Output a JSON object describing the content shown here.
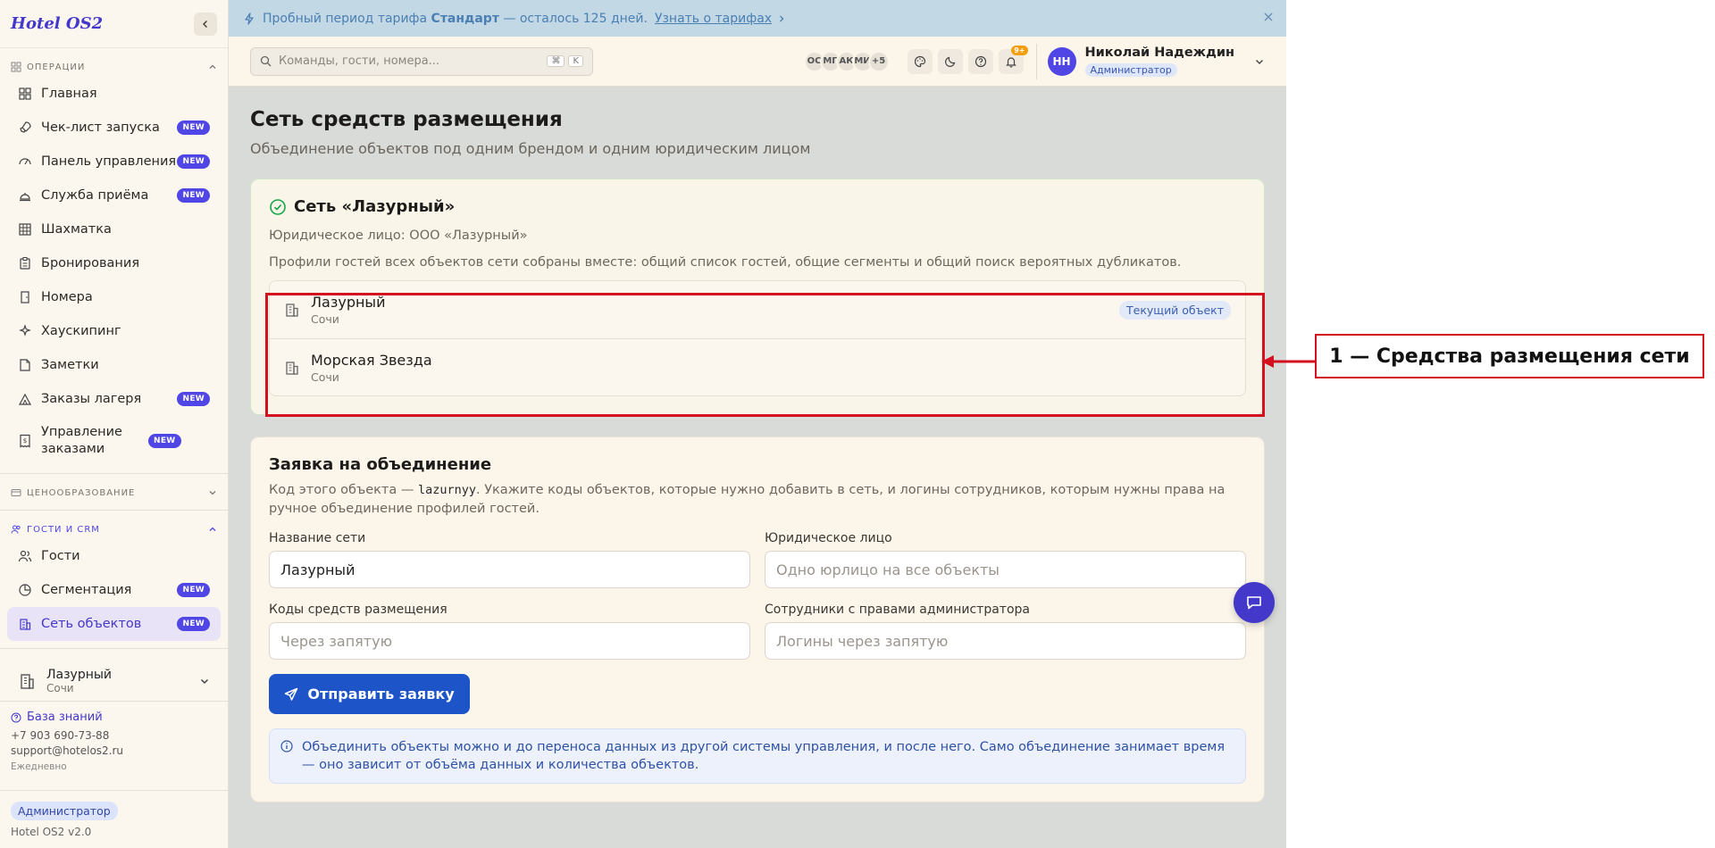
{
  "app": {
    "logo": "Hotel OS2"
  },
  "sidebar": {
    "sections": {
      "operations": "ОПЕРАЦИИ",
      "pricing": "ЦЕНООБРАЗОВАНИЕ",
      "guests_crm": "ГОСТИ И CRM"
    },
    "new_badge": "NEW",
    "items": [
      {
        "label": "Главная",
        "icon": "grid-icon",
        "new": false
      },
      {
        "label": "Чек-лист запуска",
        "icon": "rocket-icon",
        "new": true
      },
      {
        "label": "Панель управления",
        "icon": "gauge-icon",
        "new": true
      },
      {
        "label": "Служба приёма",
        "icon": "concierge-bell-icon",
        "new": true
      },
      {
        "label": "Шахматка",
        "icon": "table-icon",
        "new": false
      },
      {
        "label": "Бронирования",
        "icon": "clipboard-icon",
        "new": false
      },
      {
        "label": "Номера",
        "icon": "door-icon",
        "new": false
      },
      {
        "label": "Хаускипинг",
        "icon": "sparkles-icon",
        "new": false
      },
      {
        "label": "Заметки",
        "icon": "note-icon",
        "new": false
      },
      {
        "label": "Заказы лагеря",
        "icon": "tent-icon",
        "new": true
      },
      {
        "label": "Управление заказами",
        "icon": "receipt-icon",
        "new": true
      }
    ],
    "crm_items": [
      {
        "label": "Гости",
        "icon": "users-icon",
        "new": false
      },
      {
        "label": "Сегментация",
        "icon": "pie-icon",
        "new": true
      },
      {
        "label": "Сеть объектов",
        "icon": "buildings-icon",
        "new": true,
        "active": true
      }
    ],
    "object_selector": {
      "name": "Лазурный",
      "city": "Сочи"
    },
    "footer": {
      "knowledge_base": "База знаний",
      "phone": "+7 903 690-73-88",
      "email": "support@hotelos2.ru",
      "hours": "Ежедневно",
      "role": "Администратор",
      "version": "Hotel OS2 v2.0"
    }
  },
  "banner": {
    "prefix": "Пробный период тарифа",
    "plan": "Стандарт",
    "suffix": "— осталось 125 дней.",
    "link": "Узнать о тарифах"
  },
  "topbar": {
    "search_placeholder": "Команды, гости, номера...",
    "kbd1": "⌘",
    "kbd2": "K",
    "avatars": [
      "ОС",
      "МГ",
      "АК",
      "МИ",
      "+5"
    ],
    "notif_count": "9+",
    "user": {
      "initials": "НН",
      "name": "Николай Надеждин",
      "role": "Администратор"
    }
  },
  "page": {
    "title": "Сеть средств размещения",
    "subtitle": "Объединение объектов под одним брендом и одним юридическим лицом"
  },
  "network": {
    "title": "Сеть «Лазурный»",
    "legal": "Юридическое лицо: ООО «Лазурный»",
    "desc": "Профили гостей всех объектов сети собраны вместе: общий список гостей, общие сегменты и общий поиск вероятных дубликатов.",
    "current_label": "Текущий объект",
    "objects": [
      {
        "name": "Лазурный",
        "city": "Сочи",
        "current": true
      },
      {
        "name": "Морская Звезда",
        "city": "Сочи",
        "current": false
      }
    ]
  },
  "form": {
    "title": "Заявка на объединение",
    "desc_before": "Код этого объекта —",
    "code": "lazurnyy",
    "desc_after": ". Укажите коды объектов, которые нужно добавить в сеть, и логины сотрудников, которым нужны права на ручное объединение профилей гостей.",
    "fields": {
      "network_name": {
        "label": "Название сети",
        "value": "Лазурный",
        "placeholder": ""
      },
      "legal_entity": {
        "label": "Юридическое лицо",
        "value": "",
        "placeholder": "Одно юрлицо на все объекты"
      },
      "codes": {
        "label": "Коды средств размещения",
        "value": "",
        "placeholder": "Через запятую"
      },
      "admins": {
        "label": "Сотрудники с правами администратора",
        "value": "",
        "placeholder": "Логины через запятую"
      }
    },
    "submit": "Отправить заявку",
    "info": "Объединить объекты можно и до переноса данных из другой системы управления, и после него. Само объединение занимает время — оно зависит от объёма данных и количества объектов."
  },
  "annotation": {
    "label": "1 — Средства размещения сети",
    "color": "#d5101e"
  }
}
